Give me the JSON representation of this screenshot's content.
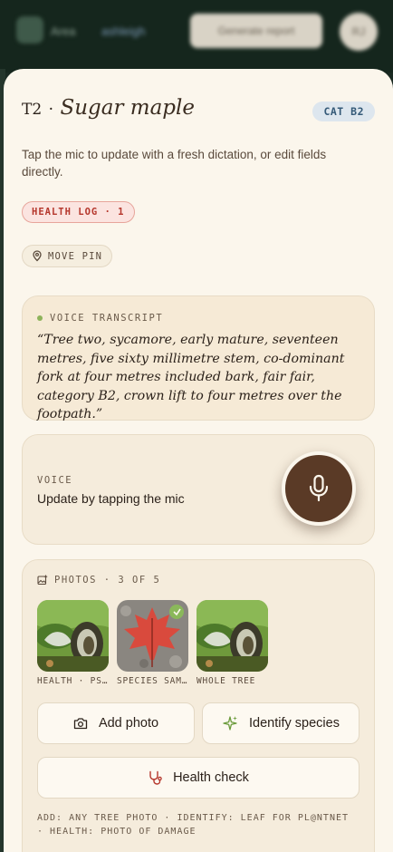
{
  "background": {
    "app_short": "Area",
    "project": "ashleigh",
    "button": "Generate report",
    "avatar": "RJ"
  },
  "sheet": {
    "tree_id": "T2",
    "separator": "·",
    "species": "Sugar maple",
    "category_badge": "CAT B2",
    "intro": "Tap the mic to update with a fresh dictation, or edit fields directly.",
    "health_log": "HEALTH LOG · 1",
    "move_pin": "MOVE PIN"
  },
  "transcript": {
    "label": "VOICE TRANSCRIPT",
    "text": "“Tree two, sycamore, early mature, seventeen metres, five sixty millimetre stem, co-dominant fork at four metres included bark, fair fair, category B2, crown lift to four metres over the footpath.”"
  },
  "voice": {
    "label": "VOICE",
    "text": "Update by tapping the mic"
  },
  "photos": {
    "label": "PHOTOS · 3 OF 5",
    "items": [
      {
        "caption": "HEALTH · PS…"
      },
      {
        "caption": "SPECIES SAM…"
      },
      {
        "caption": "WHOLE TREE"
      }
    ],
    "add_photo": "Add photo",
    "identify_species": "Identify species",
    "health_check": "Health check",
    "footnote": "ADD: ANY TREE PHOTO · IDENTIFY: LEAF FOR PL@NTNET · HEALTH: PHOTO OF DAMAGE"
  },
  "colors": {
    "sheet_bg": "#fbf6ec",
    "mic": "#5a3a26",
    "health_red": "#b5372c",
    "leaf_green": "#6a9a3a"
  }
}
